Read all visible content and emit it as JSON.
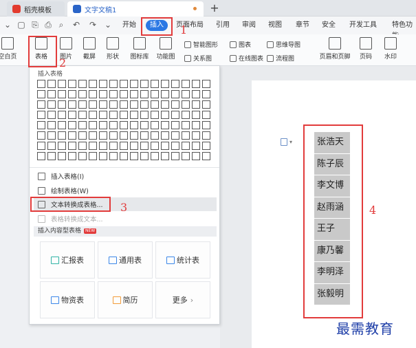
{
  "tabs": [
    {
      "label": "稻壳模板"
    },
    {
      "label": "文字文稿1"
    }
  ],
  "menu": [
    "开始",
    "插入",
    "页面布局",
    "引用",
    "审阅",
    "视图",
    "章节",
    "安全",
    "开发工具",
    "特色功能"
  ],
  "menu_active": "插入",
  "ribbon": {
    "blank_page": "空白页",
    "table": "表格",
    "picture": "图片",
    "screenshot": "截屏",
    "shapes": "形状",
    "icon_lib": "图标库",
    "function_chart": "功能图",
    "smart_art": "智能图形",
    "chart": "图表",
    "mind_map": "思维导图",
    "relation": "关系图",
    "online_chart": "在线图表",
    "flowchart": "流程图",
    "header_footer": "页眉和页脚",
    "page_num": "页码",
    "watermark": "水印"
  },
  "dropdown": {
    "title": "插入表格",
    "items": [
      {
        "label": "插入表格(I)"
      },
      {
        "label": "绘制表格(W)"
      },
      {
        "label": "文本转换成表格..."
      },
      {
        "label": "表格转换成文本..."
      }
    ],
    "section_title": "插入内容型表格",
    "badge": "NEW",
    "cards": [
      "汇报表",
      "通用表",
      "统计表",
      "物资表",
      "简历",
      "更多"
    ],
    "more_arrow": "›"
  },
  "annotations": [
    "1",
    "2",
    "3",
    "4"
  ],
  "document": {
    "names": [
      "张浩天",
      "陈子辰",
      "李文博",
      "赵雨涵",
      "王子",
      "康乃馨",
      "李明泽",
      "张毅明"
    ]
  },
  "watermark": "最需教育",
  "colors": {
    "accent": "#2b78e4",
    "annotation_red": "#e23b3b",
    "selection_gray": "#c9c9c9",
    "watermark_blue": "#1f3fa8"
  }
}
